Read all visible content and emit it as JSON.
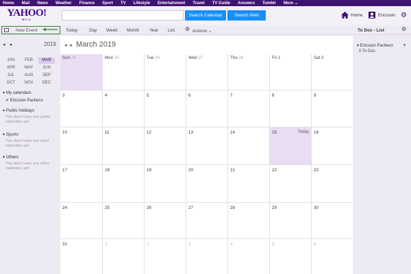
{
  "topnav": [
    "Home",
    "Mail",
    "News",
    "Weather",
    "Finance",
    "Sport",
    "TV",
    "Lifestyle",
    "Entertainment",
    "Travel",
    "TV Guide",
    "Answers",
    "Tumblr",
    "More ⌄"
  ],
  "header": {
    "logo_brand": "YAHOO!",
    "logo_sub": "MAIL",
    "search_value": "",
    "search_calendar_label": "Search Calendar",
    "search_web_label": "Search Web",
    "home_label": "Home",
    "user_label": "Ericsson"
  },
  "toolbar": {
    "new_event_label": "New Event",
    "views": [
      "Today",
      "Day",
      "Week",
      "Month",
      "Year",
      "List"
    ],
    "actions_label": "Actions ⌄"
  },
  "sidebar": {
    "year": "2019",
    "prev_arrow": "◂",
    "next_arrow": "▸",
    "months": [
      "JAN",
      "FEB",
      "MAR",
      "APR",
      "MAY",
      "JUN",
      "JUL",
      "AUG",
      "SEP",
      "OCT",
      "NOV",
      "DEC"
    ],
    "selected_month": "MAR",
    "my_calendars_title": "▾ My calendars",
    "my_calendar_item": "✔ Ericsson Pacheco",
    "holidays_title": "▾ Public holidays",
    "holidays_sub": "You don't have any public calendars yet",
    "sports_title": "▾ Sports",
    "sports_sub": "You don't have any sport calendars yet",
    "others_title": "▾ Others",
    "others_sub": "You don't have any other calendars yet"
  },
  "calendar": {
    "month_title": "March 2019",
    "prev_arrow": "◂",
    "next_arrow": "▸",
    "today_label": "Today",
    "header_days": [
      {
        "name": "Sun",
        "date": "24"
      },
      {
        "name": "Mon",
        "date": "25"
      },
      {
        "name": "Tue",
        "date": "26"
      },
      {
        "name": "Wed",
        "date": "27"
      },
      {
        "name": "Thu",
        "date": "28"
      },
      {
        "name": "Fri",
        "date": "1"
      },
      {
        "name": "Sat",
        "date": "2"
      }
    ],
    "weeks": [
      [
        "3",
        "4",
        "5",
        "6",
        "7",
        "8",
        "9"
      ],
      [
        "10",
        "11",
        "12",
        "13",
        "14",
        "15",
        "16"
      ],
      [
        "17",
        "18",
        "19",
        "20",
        "21",
        "22",
        "23"
      ],
      [
        "24",
        "25",
        "26",
        "27",
        "28",
        "29",
        "30"
      ],
      [
        "31",
        "1",
        "2",
        "3",
        "4",
        "5",
        "6"
      ]
    ],
    "today_date": "15"
  },
  "todo": {
    "title": "To Dos - List",
    "user": "▾ Ericsson Pacheco",
    "count": "0 To Dos",
    "plus": "+"
  },
  "colors": {
    "topnav": "#3f1370",
    "accent_button": "#188fff",
    "highlight_cell": "#e9ddf2",
    "new_event_box": "#2e8b2e"
  }
}
